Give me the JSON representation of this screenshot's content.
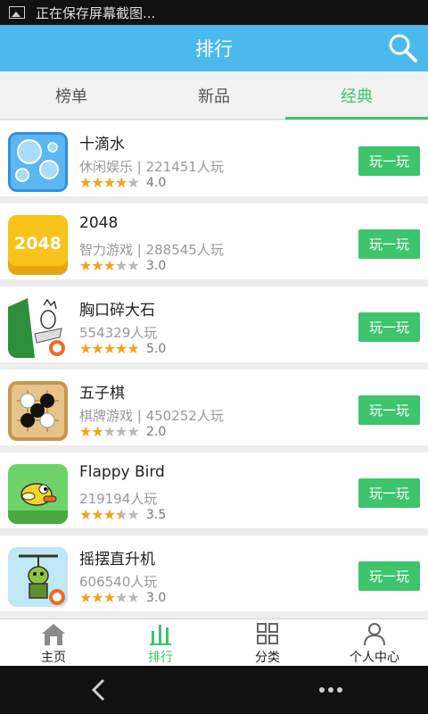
{
  "status_bar": {
    "icon": "image-icon",
    "text": "正在保存屏幕截图..."
  },
  "header": {
    "title": "排行",
    "search_icon": "search-icon"
  },
  "tabs": [
    {
      "label": "榜单",
      "active": false
    },
    {
      "label": "新品",
      "active": false
    },
    {
      "label": "经典",
      "active": true
    }
  ],
  "games": [
    {
      "name": "十滴水",
      "meta": "休闲娱乐 | 221451人玩",
      "rating": 4.0,
      "rating_text": "4.0",
      "play_label": "玩一玩",
      "icon": "water-drops-icon"
    },
    {
      "name": "2048",
      "meta": "智力游戏 | 288545人玩",
      "rating": 3.0,
      "rating_text": "3.0",
      "play_label": "玩一玩",
      "icon": "2048-icon",
      "icon_text": "2048"
    },
    {
      "name": "胸口碎大石",
      "meta": "554329人玩",
      "rating": 5.0,
      "rating_text": "5.0",
      "play_label": "玩一玩",
      "icon": "rock-smash-icon"
    },
    {
      "name": "五子棋",
      "meta": "棋牌游戏 | 450252人玩",
      "rating": 2.0,
      "rating_text": "2.0",
      "play_label": "玩一玩",
      "icon": "gomoku-icon"
    },
    {
      "name": "Flappy Bird",
      "meta": "219194人玩",
      "rating": 3.5,
      "rating_text": "3.5",
      "play_label": "玩一玩",
      "icon": "flappy-bird-icon"
    },
    {
      "name": "摇摆直升机",
      "meta": "606540人玩",
      "rating": 3.0,
      "rating_text": "3.0",
      "play_label": "玩一玩",
      "icon": "swing-copter-icon"
    }
  ],
  "bottom_nav": [
    {
      "label": "主页",
      "icon": "home-icon",
      "active": false
    },
    {
      "label": "排行",
      "icon": "ranking-icon",
      "active": true
    },
    {
      "label": "分类",
      "icon": "grid-icon",
      "active": false
    },
    {
      "label": "个人中心",
      "icon": "person-icon",
      "active": false
    }
  ],
  "system_nav": {
    "back": "back-icon",
    "more": "more-icon"
  },
  "colors": {
    "accent_green": "#3ec46d",
    "header_blue": "#4bb9ed",
    "star": "#f2a31c"
  }
}
